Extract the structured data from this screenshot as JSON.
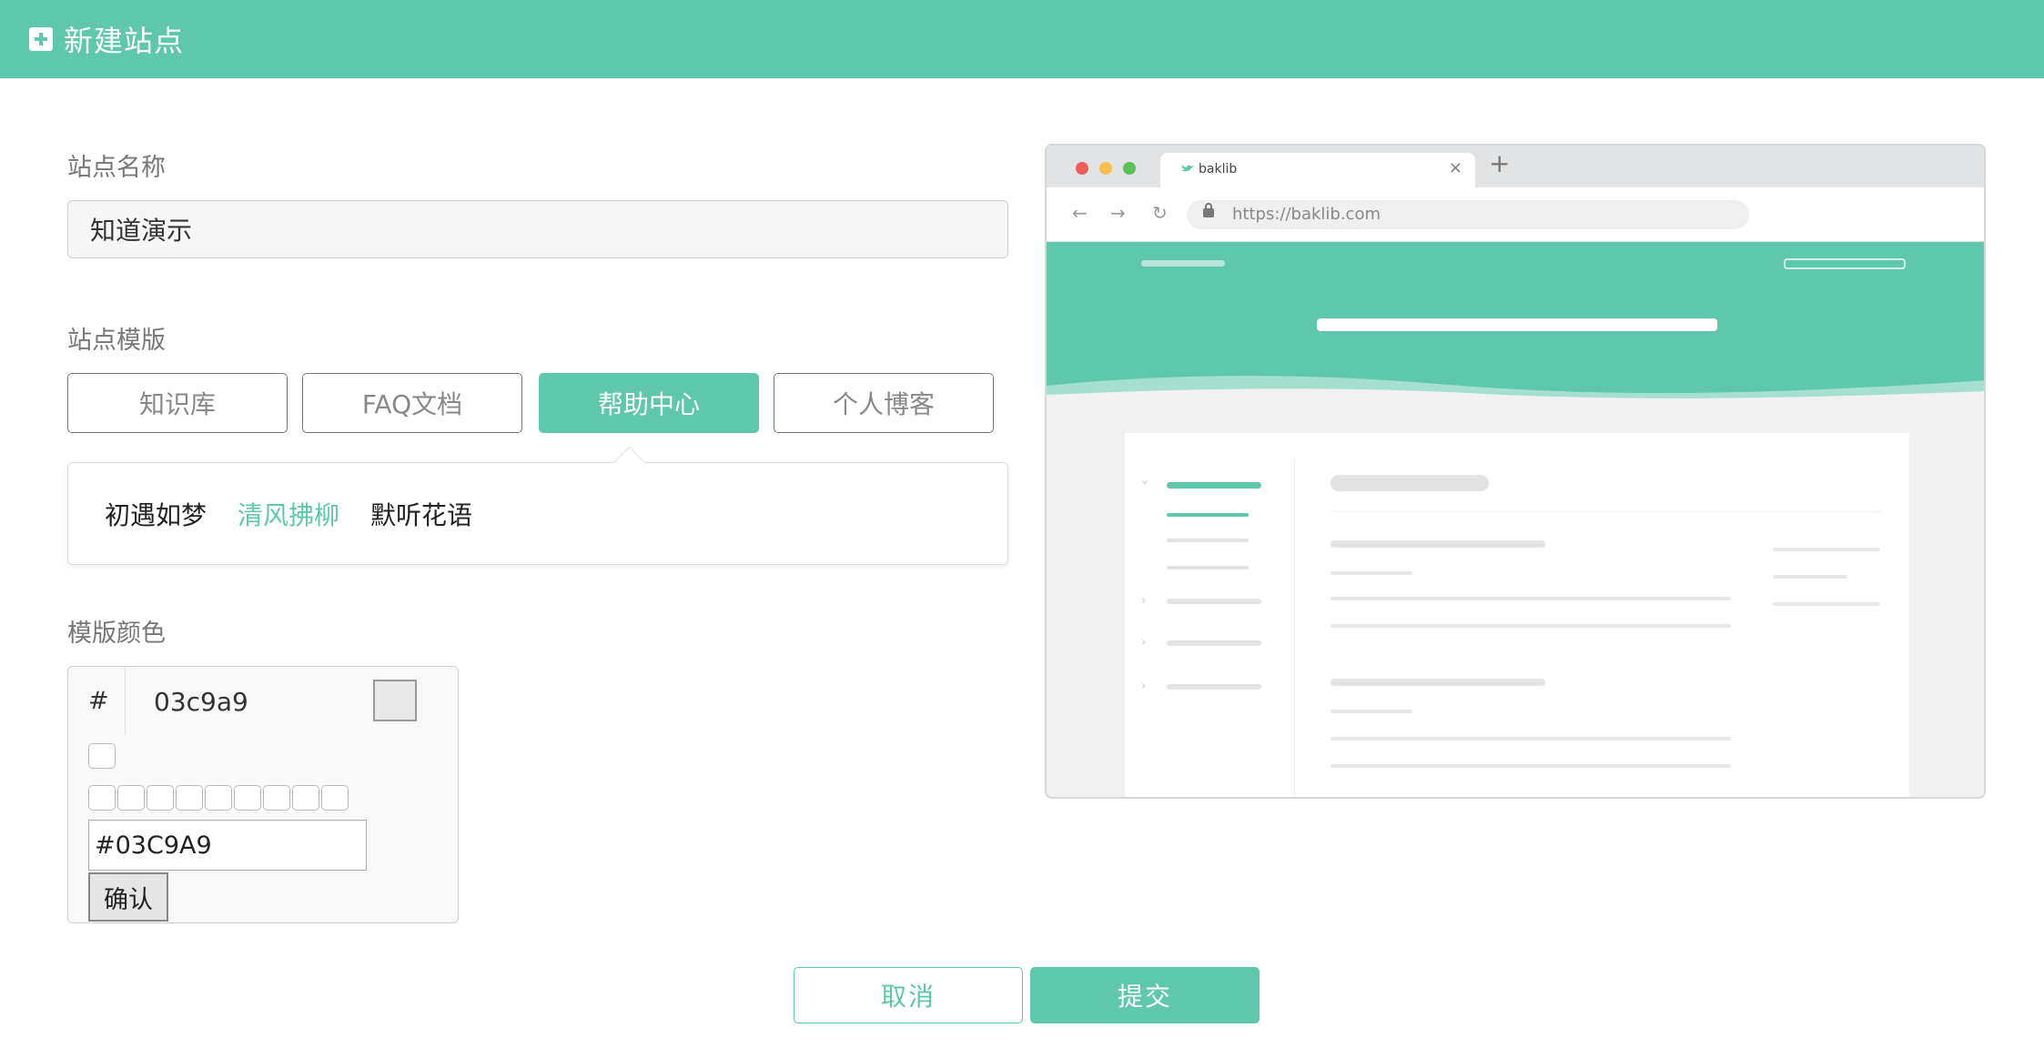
{
  "header": {
    "title": "新建站点"
  },
  "form": {
    "site_name_label": "站点名称",
    "site_name_value": "知道演示",
    "template_label": "站点模版",
    "templates": [
      {
        "label": "知识库",
        "active": false
      },
      {
        "label": "FAQ文档",
        "active": false
      },
      {
        "label": "帮助中心",
        "active": true
      },
      {
        "label": "个人博客",
        "active": false
      }
    ],
    "styles": [
      {
        "label": "初遇如梦",
        "active": false
      },
      {
        "label": "清风拂柳",
        "active": true
      },
      {
        "label": "默听花语",
        "active": false
      }
    ],
    "color_label": "模版颜色",
    "color_picker": {
      "hash_symbol": "#",
      "hex_display": "03c9a9",
      "hex_input_value": "#03C9A9",
      "confirm_label": "确认",
      "preset_swatch_count": 9
    }
  },
  "actions": {
    "cancel_label": "取消",
    "submit_label": "提交"
  },
  "preview": {
    "tab_title": "baklib",
    "tab_close": "×",
    "new_tab": "+",
    "url": "https://baklib.com",
    "back_icon": "←",
    "forward_icon": "→",
    "reload_icon": "↻"
  },
  "colors": {
    "accent": "#5ec7ac",
    "traffic_red": "#ee5f5a",
    "traffic_yellow": "#f6be4f",
    "traffic_green": "#5ac05a"
  }
}
